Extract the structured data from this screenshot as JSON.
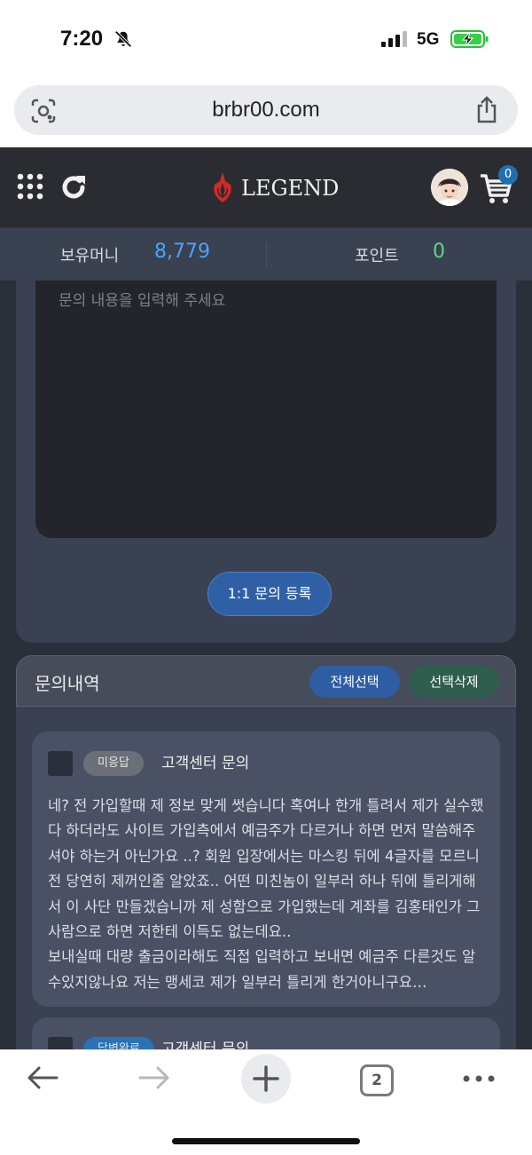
{
  "status_bar": {
    "time": "7:20",
    "network": "5G"
  },
  "browser": {
    "url": "brbr00.com",
    "tab_count": "2"
  },
  "site": {
    "logo_text": "LEGEND",
    "cart_count": "0",
    "balance_label": "보유머니",
    "balance_value": "8,779",
    "points_label": "포인트",
    "points_value": "0"
  },
  "inquiry_form": {
    "placeholder": "문의 내용을 입력해 주세요",
    "submit_label": "1:1 문의 등록"
  },
  "history": {
    "title": "문의내역",
    "select_all_label": "전체선택",
    "delete_selected_label": "선택삭제",
    "items": [
      {
        "status": "미응답",
        "title": "고객센터 문의",
        "body": "네? 전 가입할때 제 정보 맞게 썻습니다 혹여나 한개 틀려서 제가 실수했다 하더라도 사이트 가입측에서 예금주가 다르거나 하면 먼저 말씀해주셔야 하는거 아닌가요 ..? 회원 입장에서는 마스킹 뒤에 4글자를 모르니 전 당연히 제꺼인줄 알았죠.. 어떤 미친놈이 일부러 하나 뒤에 틀리게해서 이 사단 만들겠습니까 제 성함으로 가입했는데 계좌를 김홍태인가 그사람으로 하면 저한테 이득도 없는데요..\n보내실때 대량 출금이라해도 직접 입력하고 보내면 예금주 다른것도 알수있지않나요 저는 맹세코 제가 일부러 틀리게 한거아니구요…"
      },
      {
        "status": "답변완료",
        "title": "고객센터 문의"
      }
    ]
  },
  "colors": {
    "accent_blue": "#4aa3ff",
    "accent_green": "#5cd68a",
    "logo_red": "#e03a2f"
  }
}
